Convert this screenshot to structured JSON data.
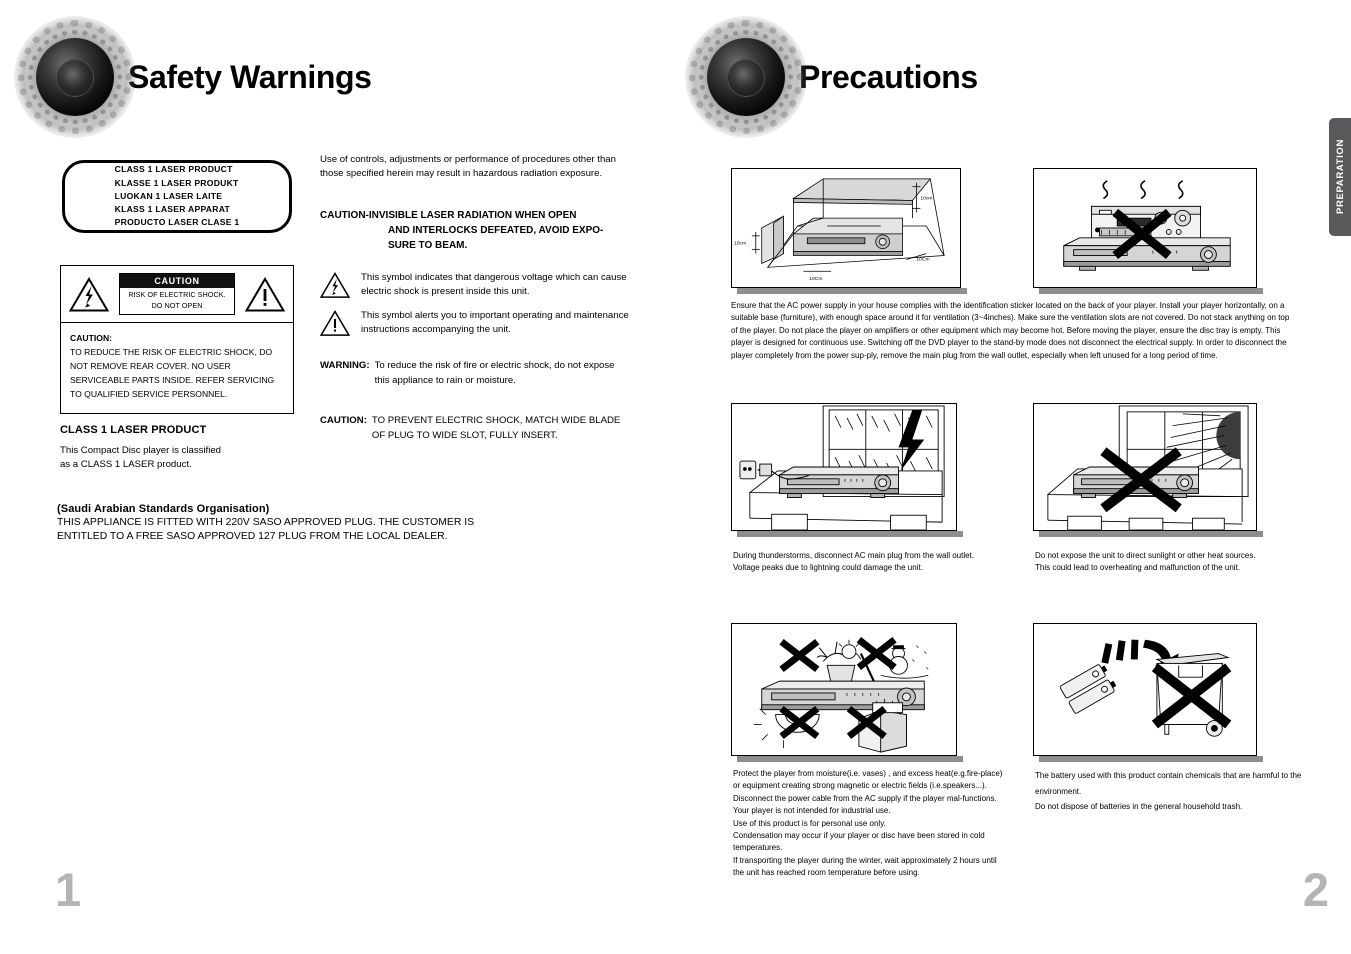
{
  "left_page": {
    "header_title": "Safety Warnings",
    "page_number": "1",
    "laser_box_lines": [
      "CLASS 1 LASER PRODUCT",
      "KLASSE 1 LASER PRODUKT",
      "LUOKAN 1 LASER LAITE",
      "KLASS 1 LASER APPARAT",
      "PRODUCTO LASER CLASE 1"
    ],
    "caution_panel": {
      "label_title": "CAUTION",
      "label_sub_line1": "RISK OF ELECTRIC SHOCK.",
      "label_sub_line2": "DO NOT OPEN",
      "body_heading": "CAUTION:",
      "body_text": "TO REDUCE THE RISK OF ELECTRIC SHOCK, DO NOT REMOVE REAR COVER. NO USER SERVICEABLE PARTS INSIDE. REFER SERVICING TO QUALIFIED SERVICE PERSONNEL."
    },
    "class1": {
      "heading": "CLASS 1 LASER PRODUCT",
      "line1": "This Compact Disc player is classified",
      "line2": "as a CLASS 1 LASER product."
    },
    "saso": {
      "heading": "(Saudi Arabian Standards Organisation)",
      "body": "THIS APPLIANCE IS FITTED WITH 220V SASO APPROVED PLUG. THE CUSTOMER IS ENTITLED TO A FREE SASO APPROVED 127 PLUG FROM THE LOCAL DEALER."
    },
    "right_col": {
      "intro": "Use of controls, adjustments or performance of procedures other than those specified herein may result in hazardous radiation exposure.",
      "laser_caution_line1": "CAUTION-INVISIBLE LASER RADIATION WHEN OPEN",
      "laser_caution_line2": "AND INTERLOCKS DEFEATED, AVOID EXPO-",
      "laser_caution_line3": "SURE TO BEAM.",
      "symbol_bolt_text": "This symbol indicates that dangerous voltage which can cause electric shock is present inside this unit.",
      "symbol_excl_text": "This symbol alerts you to important operating and maintenance instructions accompanying the unit.",
      "warning_label": "WARNING:",
      "warning_text": "To reduce the risk of fire or electric shock, do not expose this appliance to rain or moisture.",
      "caution_label": "CAUTION:",
      "caution_text": "TO PREVENT ELECTRIC SHOCK, MATCH WIDE BLADE OF PLUG TO WIDE SLOT, FULLY INSERT."
    }
  },
  "right_page": {
    "header_title": "Precautions",
    "page_number": "2",
    "side_tab_label": "PREPARATION",
    "figures": {
      "ventilation": {
        "name": "ventilation-clearance-diagram",
        "dim_left": "10cm",
        "dim_right": "10cm",
        "dim_front": "10Cm",
        "dim_bottom": "10Cm"
      },
      "no_stacking": {
        "name": "no-stacking-diagram"
      },
      "thunderstorm": {
        "name": "thunderstorm-unplug-diagram"
      },
      "sunlight": {
        "name": "no-direct-sunlight-diagram"
      },
      "moisture_heat": {
        "name": "moisture-and-heat-hazards-diagram"
      },
      "battery_disposal": {
        "name": "battery-disposal-diagram"
      }
    },
    "ventilation_paragraph": "Ensure that the AC power supply in your house complies with the identification sticker located on the back of your player. Install your player horizontally, on a suitable base (furniture), with enough space around it for ventilation (3~4inches). Make sure the ventilation slots are not covered. Do not stack anything on top of the player. Do not place the player on amplifiers or other equipment which may become hot. Before moving the player, ensure the disc tray is empty. This player is designed for continuous use. Switching off the DVD player to the stand-by mode does not disconnect the electrical supply. In order to disconnect the player completely from the power sup-ply, remove the main plug from the wall outlet, especially when left unused for a long period of time.",
    "caption_thunderstorm": [
      "During thunderstorms, disconnect AC main plug from the wall outlet.",
      "Voltage peaks due to lightning could damage the unit."
    ],
    "caption_sunlight": [
      "Do not expose the unit to direct sunlight or other heat sources.",
      "This could lead to overheating and malfunction of the unit."
    ],
    "caption_moisture": [
      "Protect the player from moisture(i.e. vases) , and excess heat(e.g.fire-place) or equipment creating strong magnetic or electric fields (i.e.speakers...). Disconnect the power cable from the AC supply if the player mal-functions. Your player is not intended for industrial use.",
      "Use of this product is for personal use only.",
      "Condensation may occur if your player or disc have been stored in cold temperatures.",
      "If transporting the player during the winter, wait approximately 2 hours until the unit has reached room temperature before using."
    ],
    "caption_battery": [
      "The battery used with this product contain chemicals that are harmful to the environment.",
      "Do not dispose of batteries in the general household trash."
    ]
  }
}
